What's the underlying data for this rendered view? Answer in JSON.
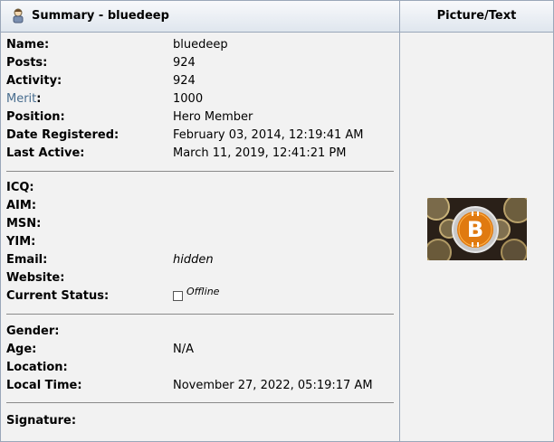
{
  "header": {
    "title": "Summary - bluedeep",
    "picture_heading": "Picture/Text"
  },
  "fields": {
    "name": {
      "label": "Name:",
      "value": "bluedeep"
    },
    "posts": {
      "label": "Posts:",
      "value": "924"
    },
    "activity": {
      "label": "Activity:",
      "value": "924"
    },
    "merit": {
      "label": "Merit",
      "colon": ":",
      "value": "1000"
    },
    "position": {
      "label": "Position:",
      "value": "Hero Member"
    },
    "date_registered": {
      "label": "Date Registered:",
      "value": "February 03, 2014, 12:19:41 AM"
    },
    "last_active": {
      "label": "Last Active:",
      "value": "March 11, 2019, 12:41:21 PM"
    },
    "icq": {
      "label": "ICQ:"
    },
    "aim": {
      "label": "AIM:"
    },
    "msn": {
      "label": "MSN:"
    },
    "yim": {
      "label": "YIM:"
    },
    "email": {
      "label": "Email:",
      "value": "hidden"
    },
    "website": {
      "label": "Website:"
    },
    "current_status": {
      "label": "Current Status:",
      "value": "Offline"
    },
    "gender": {
      "label": "Gender:"
    },
    "age": {
      "label": "Age:",
      "value": "N/A"
    },
    "location": {
      "label": "Location:"
    },
    "local_time": {
      "label": "Local Time:",
      "value": "November 27, 2022, 05:19:17 AM"
    },
    "signature": {
      "label": "Signature:"
    }
  },
  "icons": {
    "header": "user-icon",
    "status": "offline-status-icon",
    "avatar": "bitcoin-avatar-image"
  },
  "colors": {
    "merit_label": "#476c8e",
    "header_border": "#9aa7b9",
    "body_bg": "#f2f2f2"
  }
}
